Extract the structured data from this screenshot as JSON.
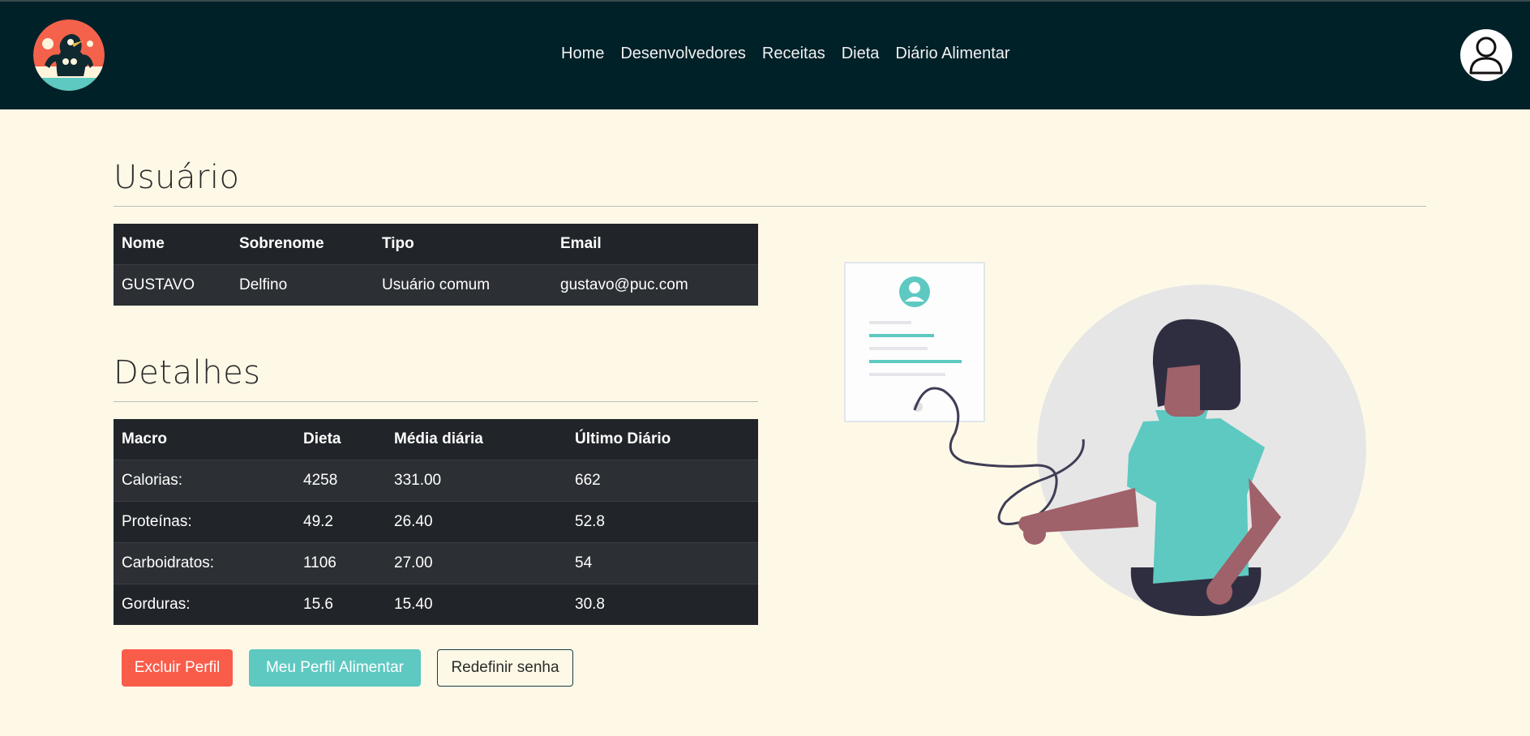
{
  "nav": {
    "links": [
      "Home",
      "Desenvolvedores",
      "Receitas",
      "Dieta",
      "Diário Alimentar"
    ]
  },
  "usuario": {
    "title": "Usuário",
    "headers": [
      "Nome",
      "Sobrenome",
      "Tipo",
      "Email"
    ],
    "row": [
      "GUSTAVO",
      "Delfino",
      "Usuário comum",
      "gustavo@puc.com"
    ]
  },
  "detalhes": {
    "title": "Detalhes",
    "headers": [
      "Macro",
      "Dieta",
      "Média diária",
      "Último Diário"
    ],
    "rows": [
      [
        "Calorias:",
        "4258",
        "331.00",
        "662"
      ],
      [
        "Proteínas:",
        "49.2",
        "26.40",
        "52.8"
      ],
      [
        "Carboidratos:",
        "1106",
        "27.00",
        "54"
      ],
      [
        "Gorduras:",
        "15.6",
        "15.40",
        "30.8"
      ]
    ]
  },
  "buttons": {
    "excluir": "Excluir Perfil",
    "perfil": "Meu Perfil Alimentar",
    "senha": "Redefinir senha"
  },
  "colors": {
    "navbar": "#012129",
    "background": "#fef9e7",
    "danger": "#fa5c4a",
    "teal": "#5ec9c1",
    "table": "#212529"
  },
  "icons": {
    "logo": "bodybuilder-bird-logo",
    "avatar": "user-avatar-icon"
  }
}
